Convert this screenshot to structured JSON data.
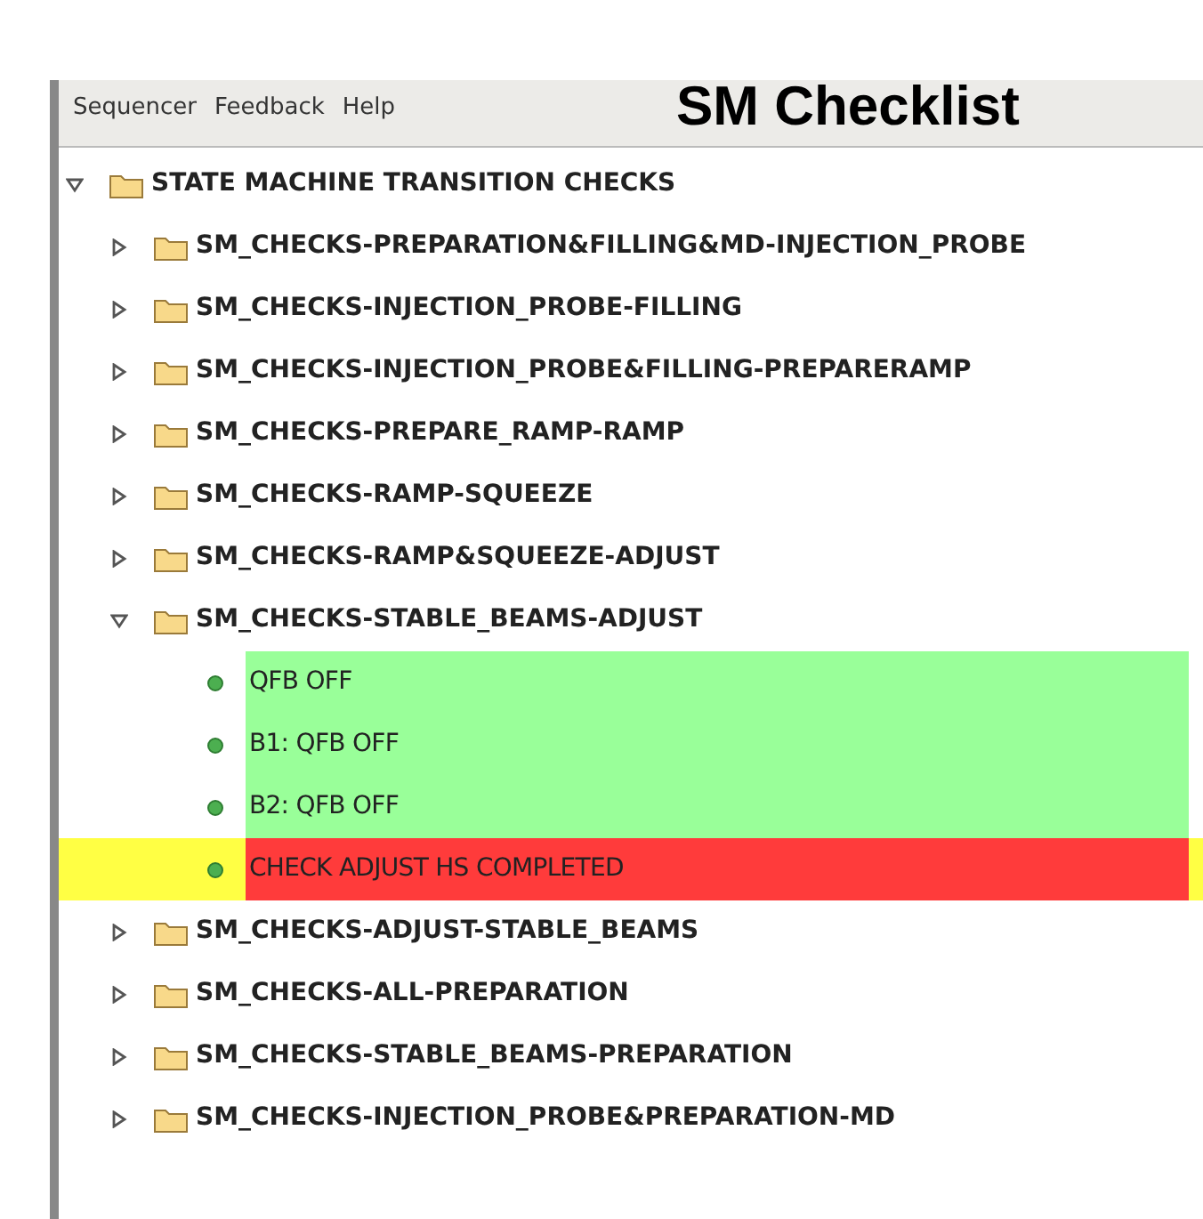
{
  "menu_bar": [
    "Sequencer",
    "Feedback",
    "Help"
  ],
  "title": "SM Checklist",
  "tree": [
    {
      "label": "STATE MACHINE TRANSITION CHECKS",
      "expanded": true,
      "children": [
        {
          "label": "SM_CHECKS-PREPARATION&FILLING&MD-INJECTION_PROBE",
          "expanded": false
        },
        {
          "label": "SM_CHECKS-INJECTION_PROBE-FILLING",
          "expanded": false
        },
        {
          "label": "SM_CHECKS-INJECTION_PROBE&FILLING-PREPARERAMP",
          "expanded": false
        },
        {
          "label": "SM_CHECKS-PREPARE_RAMP-RAMP",
          "expanded": false
        },
        {
          "label": "SM_CHECKS-RAMP-SQUEEZE",
          "expanded": false
        },
        {
          "label": "SM_CHECKS-RAMP&SQUEEZE-ADJUST",
          "expanded": false
        },
        {
          "label": "SM_CHECKS-STABLE_BEAMS-ADJUST",
          "expanded": true,
          "children": [
            {
              "kind": "check",
              "label": "QFB OFF",
              "color": "#99ff99",
              "selected": false
            },
            {
              "kind": "check",
              "label": "B1: QFB OFF",
              "color": "#99ff99",
              "selected": false
            },
            {
              "kind": "check",
              "label": "B2: QFB OFF",
              "color": "#99ff99",
              "selected": false
            },
            {
              "kind": "check",
              "label": "CHECK ADJUST HS COMPLETED",
              "color": "#ff3b3b",
              "selected": true
            }
          ]
        },
        {
          "label": "SM_CHECKS-ADJUST-STABLE_BEAMS",
          "expanded": false
        },
        {
          "label": "SM_CHECKS-ALL-PREPARATION",
          "expanded": false
        },
        {
          "label": "SM_CHECKS-STABLE_BEAMS-PREPARATION",
          "expanded": false
        },
        {
          "label": "SM_CHECKS-INJECTION_PROBE&PREPARATION-MD",
          "expanded": false
        }
      ]
    }
  ]
}
